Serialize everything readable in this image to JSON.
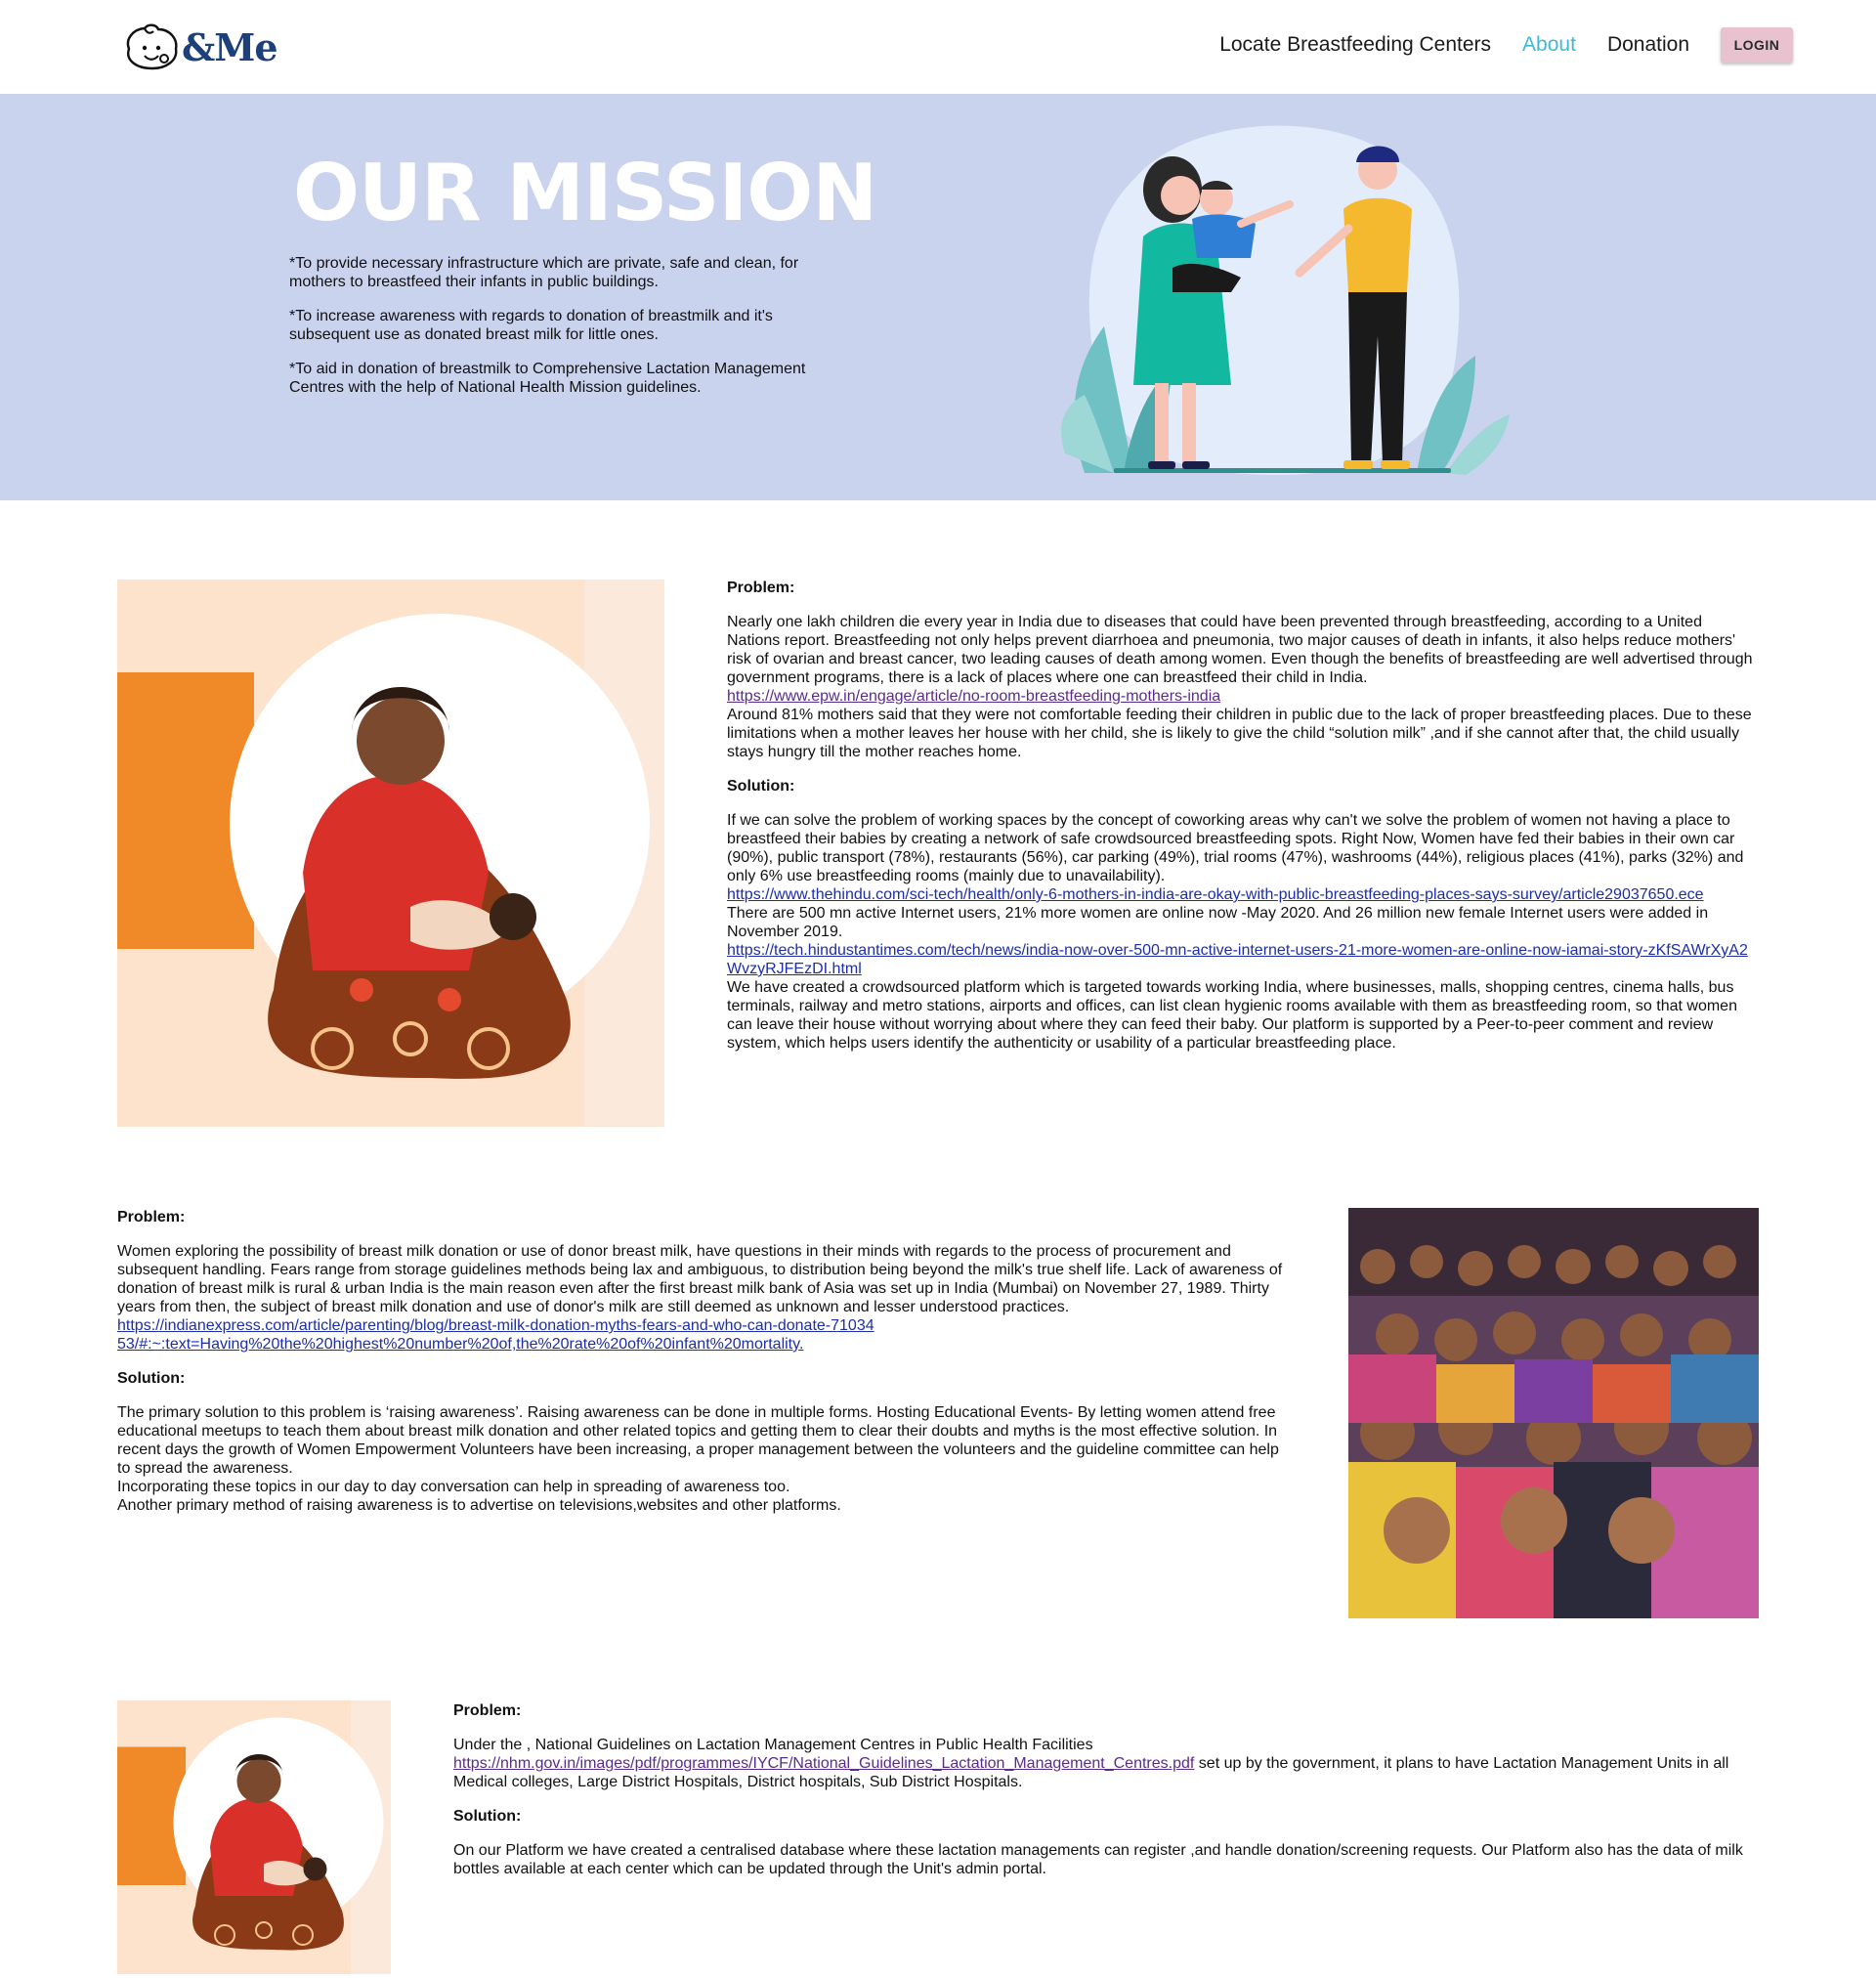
{
  "brand": {
    "name": "&Me"
  },
  "nav": {
    "items": [
      {
        "label": "Locate Breastfeeding Centers",
        "active": false
      },
      {
        "label": "About",
        "active": true
      },
      {
        "label": "Donation",
        "active": false
      }
    ],
    "login_label": "LOGIN"
  },
  "mission": {
    "title": "OUR MISSION",
    "points": [
      "*To provide necessary infrastructure which are private, safe and clean, for mothers to breastfeed their infants in public buildings.",
      "*To increase awareness with regards to donation of breastmilk and it's subsequent use as donated breast milk for little ones.",
      "*To aid in donation of breastmilk to Comprehensive Lactation Management Centres with the help of National Health Mission guidelines."
    ]
  },
  "section1": {
    "problem_heading": "Problem:",
    "problem_text": "Nearly one lakh children die every year in India due to diseases that could have been prevented through breastfeeding, according to a United Nations report. Breastfeeding not only helps prevent diarrhoea and pneumonia, two major causes of death in infants, it also helps reduce mothers' risk of ovarian and breast cancer, two leading causes of death among women. Even though the benefits of breastfeeding are well advertised through government programs, there is a lack of places where one can breastfeed their child in India.",
    "problem_link": "https://www.epw.in/engage/article/no-room-breastfeeding-mothers-india",
    "problem_text2": "Around 81% mothers said that they were not comfortable feeding their children in public due to the lack of proper breastfeeding places. Due to these limitations when a mother leaves her house with her child, she is likely to give the child “solution milk” ,and if she cannot after that, the child usually stays hungry till the mother reaches home.",
    "solution_heading": "Solution:",
    "solution_text": "If we can solve the problem of working spaces by the concept of coworking areas why can't we solve the problem of women not having a place to breastfeed their babies by creating a network of safe crowdsourced breastfeeding spots. Right Now, Women have fed their babies in their own car (90%), public transport (78%), restaurants (56%), car parking (49%), trial rooms (47%), washrooms (44%), religious places (41%), parks (32%) and only 6% use breastfeeding rooms (mainly due to unavailability).",
    "solution_link1": "https://www.thehindu.com/sci-tech/health/only-6-mothers-in-india-are-okay-with-public-breastfeeding-places-says-survey/article29037650.ece",
    "solution_text2": "There are 500 mn active Internet users, 21% more women are online now -May 2020. And 26 million new female Internet users were added in November 2019.",
    "solution_link2": "https://tech.hindustantimes.com/tech/news/india-now-over-500-mn-active-internet-users-21-more-women-are-online-now-iamai-story-zKfSAWrXyA2WvzyRJFEzDI.html",
    "solution_text3": "We have created a crowdsourced platform which is targeted towards working India, where businesses, malls, shopping centres, cinema halls, bus terminals, railway and metro stations, airports and offices, can list clean hygienic rooms available with them as breastfeeding room, so that women can leave their house without worrying about where they can feed their baby. Our platform is supported by a Peer-to-peer comment and review system, which helps users identify the authenticity or usability of a particular breastfeeding place."
  },
  "section2": {
    "problem_heading": "Problem:",
    "problem_text": "Women exploring the possibility of breast milk donation or use of donor breast milk, have questions in their minds with regards to the process of procurement and subsequent handling. Fears range from storage guidelines methods being lax and ambiguous, to distribution being beyond the milk's true shelf life. Lack of awareness of donation of breast milk is rural & urban India is the main reason even after the first breast milk bank of Asia was set up in India (Mumbai) on November 27, 1989. Thirty years from then, the subject of breast milk donation and use of donor's milk are still deemed as unknown and lesser understood practices.",
    "problem_link": "https://indianexpress.com/article/parenting/blog/breast-milk-donation-myths-fears-and-who-can-donate-7103453/#:~:text=Having%20the%20highest%20number%20of,the%20rate%20of%20infant%20mortality.",
    "solution_heading": "Solution:",
    "solution_text": "The primary solution to this problem is ‘raising awareness’. Raising awareness can be done in multiple forms. Hosting Educational Events- By letting women attend free educational meetups to teach them about breast milk donation and other related topics and getting them to clear their doubts and myths is the most effective solution. In recent days the growth of Women Empowerment Volunteers have been increasing, a proper management between the volunteers and the guideline committee can help to spread the awareness.",
    "solution_text2": "Incorporating these topics in our day to day conversation can help in spreading of awareness too.",
    "solution_text3": "Another primary method of raising awareness is to advertise on televisions,websites and other platforms."
  },
  "section3": {
    "problem_heading": "Problem:",
    "problem_text": "Under the , National Guidelines on Lactation Management Centres in Public Health Facilities",
    "problem_link": "https://nhm.gov.in/images/pdf/programmes/IYCF/National_Guidelines_Lactation_Management_Centres.pdf",
    "problem_text2": " set up by the government, it plans to have Lactation Management Units in all Medical colleges, Large District Hospitals, District hospitals, Sub District Hospitals.",
    "solution_heading": "Solution:",
    "solution_text": "On our Platform we have created a centralised database where these lactation managements can register ,and handle donation/screening requests. Our Platform also has the data of milk bottles available at each center which can be updated through the Unit's admin portal."
  },
  "colors": {
    "banner_bg": "#cad3ee",
    "accent_nav": "#3fb9d6",
    "login_bg": "#e8c3cf",
    "brand": "#1d3f7a",
    "link": "#1d2ea8",
    "link_visited": "#5b2b8a",
    "image_peach": "#fde2cc",
    "image_orange": "#f08a28"
  }
}
